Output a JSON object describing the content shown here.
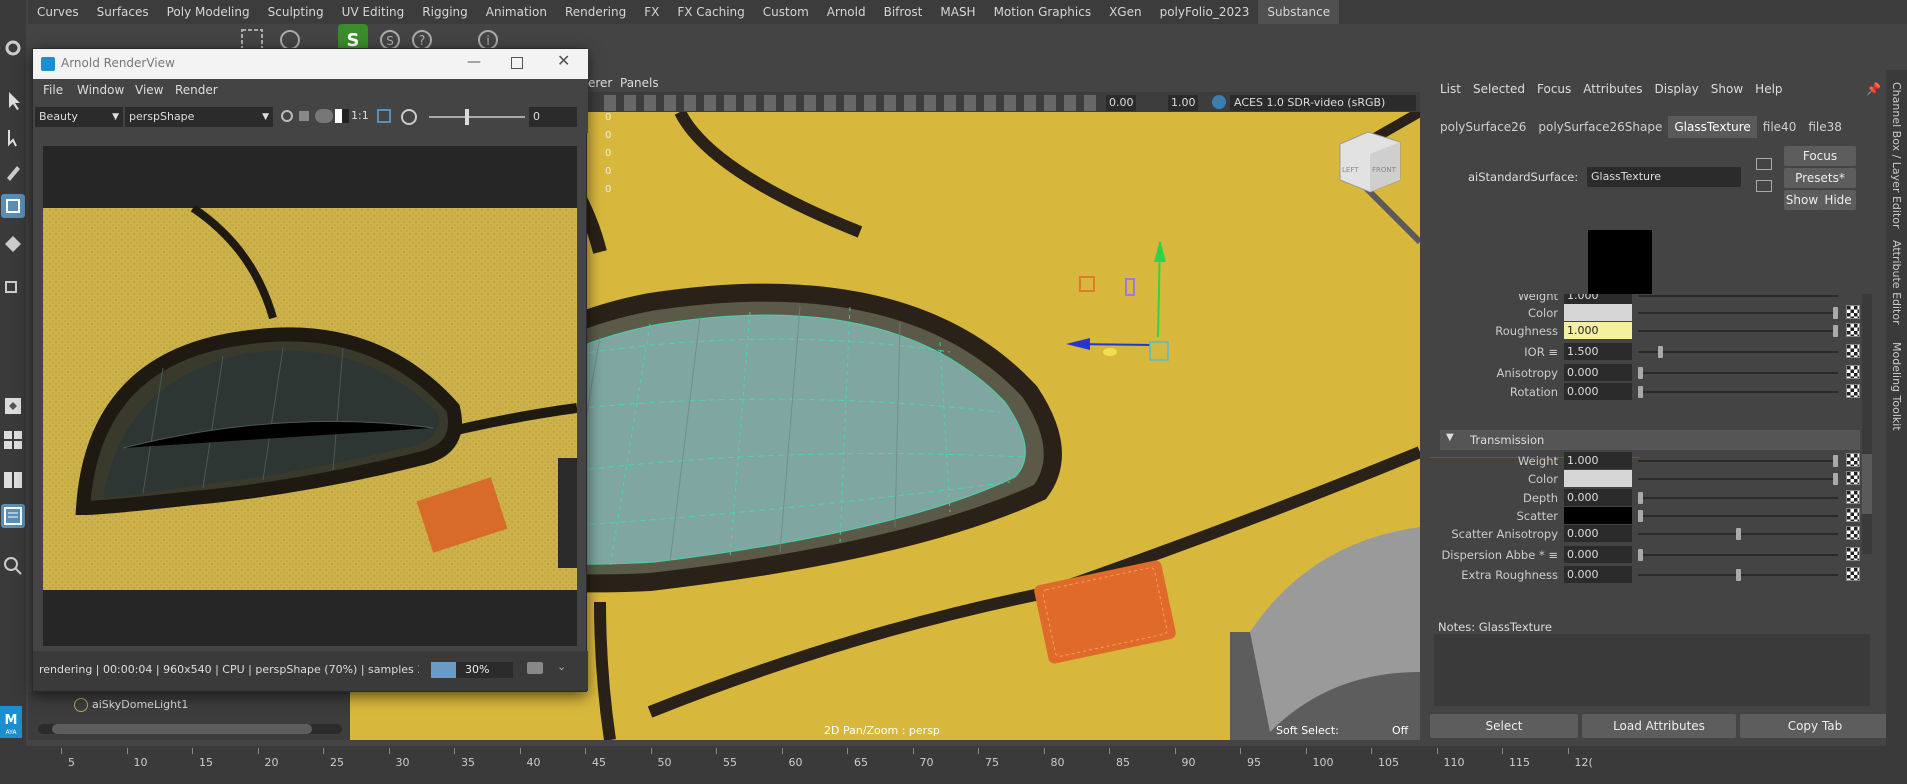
{
  "shelf": {
    "tabs": [
      "Curves",
      "Surfaces",
      "Poly Modeling",
      "Sculpting",
      "UV Editing",
      "Rigging",
      "Animation",
      "Rendering",
      "FX",
      "FX Caching",
      "Custom",
      "Arnold",
      "Bifrost",
      "MASH",
      "Motion Graphics",
      "XGen",
      "polyFolio_2023",
      "Substance"
    ],
    "active_tab": "Substance"
  },
  "render_view": {
    "title": "Arnold RenderView",
    "menus": [
      "File",
      "Window",
      "View",
      "Render"
    ],
    "aov": "Beauty",
    "camera": "perspShape",
    "ratio": "1:1",
    "exposure": "0",
    "status": "rendering | 00:00:04 | 960x540 | CPU | perspShape (70%) | samples 3/...",
    "progress_label": "30%",
    "progress": 0.3
  },
  "viewport": {
    "menu_partial": "erer",
    "menu_panels": "Panels",
    "field_a": "0.00",
    "field_b": "1.00",
    "color_space": "ACES 1.0 SDR-video (sRGB)",
    "hud_zeros": [
      "0",
      "0",
      "0",
      "0",
      "0"
    ],
    "cube_left": "LEFT",
    "cube_front": "FRONT",
    "footer_center": "2D Pan/Zoom : persp",
    "footer_soft_select": "Soft Select:",
    "footer_soft_value": "Off"
  },
  "outliner": {
    "item": "aiSkyDomeLight1"
  },
  "attribute_editor": {
    "menus": [
      "List",
      "Selected",
      "Focus",
      "Attributes",
      "Display",
      "Show",
      "Help"
    ],
    "tabs": [
      "polySurface26",
      "polySurface26Shape",
      "GlassTexture",
      "file40",
      "file38"
    ],
    "active_tab": "GlassTexture",
    "node_type_label": "aiStandardSurface:",
    "node_name": "GlassTexture",
    "focus_button": "Focus",
    "presets_button": "Presets*",
    "show_button": "Show",
    "hide_button": "Hide",
    "partial_top_label": "Weight",
    "partial_top_value": "1.000",
    "specular_rows": [
      {
        "label": "Color",
        "value": "",
        "slider": 1.0
      },
      {
        "label": "Roughness",
        "value": "1.000",
        "slider": 1.0
      },
      {
        "label": "IOR ≡",
        "value": "1.500",
        "slider": 0.1
      },
      {
        "label": "Anisotropy",
        "value": "0.000",
        "slider": 0.0
      },
      {
        "label": "Rotation",
        "value": "0.000",
        "slider": 0.0
      }
    ],
    "section_title": "Transmission",
    "transmission_rows": [
      {
        "label": "Weight",
        "value": "1.000",
        "slider": 1.0
      },
      {
        "label": "Color",
        "value": "",
        "slider": 1.0
      },
      {
        "label": "Depth",
        "value": "0.000",
        "slider": 0.0
      },
      {
        "label": "Scatter",
        "value": "",
        "slider": 0.0
      },
      {
        "label": "Scatter Anisotropy",
        "value": "0.000",
        "slider": 0.5
      },
      {
        "label": "Dispersion Abbe * ≡",
        "value": "0.000",
        "slider": 0.0
      },
      {
        "label": "Extra Roughness",
        "value": "0.000",
        "slider": 0.5
      }
    ],
    "notes_label": "Notes:  GlassTexture",
    "bottom_buttons": [
      "Select",
      "Load Attributes",
      "Copy Tab"
    ]
  },
  "side_labels": [
    "Channel Box / Layer Editor",
    "Attribute Editor",
    "Modeling Toolkit"
  ],
  "timeline": {
    "ticks": [
      "5",
      "10",
      "15",
      "20",
      "25",
      "30",
      "35",
      "40",
      "45",
      "50",
      "55",
      "60",
      "65",
      "70",
      "75",
      "80",
      "85",
      "90",
      "95",
      "100",
      "105",
      "110",
      "115",
      "12("
    ]
  },
  "colors": {
    "accent": "#5b8eb5",
    "viewport_yellow": "#d6b63a",
    "glass": "#7fa6a0",
    "wireframe": "#3fe0b0",
    "roughness_field": "#f4f0a0"
  }
}
